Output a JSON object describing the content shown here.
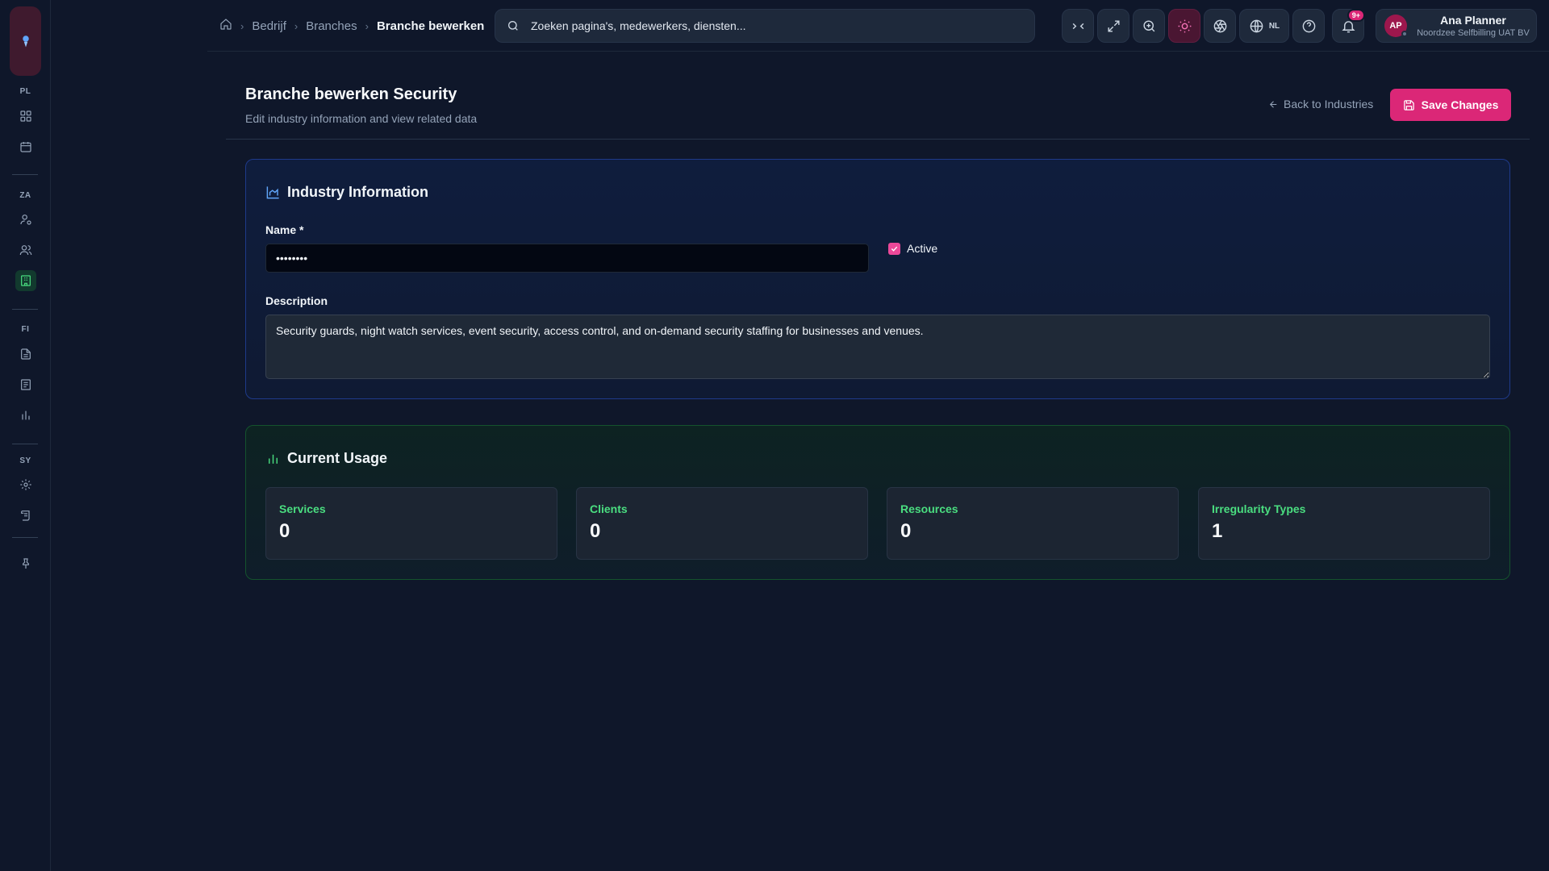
{
  "sidebar": {
    "sections": [
      {
        "label": "PL",
        "items": [
          "dashboard-icon",
          "calendar-icon"
        ]
      },
      {
        "label": "ZA",
        "items": [
          "user-settings-icon",
          "users-icon",
          "building-icon"
        ]
      },
      {
        "label": "FI",
        "items": [
          "file-text-icon",
          "receipt-icon",
          "bar-chart-icon"
        ]
      },
      {
        "label": "SY",
        "items": [
          "settings-icon",
          "scroll-icon"
        ]
      }
    ],
    "active_item": "building-icon",
    "pin_icon": "pin-icon"
  },
  "breadcrumbs": {
    "items": [
      "Bedrijf",
      "Branches"
    ],
    "current": "Branche bewerken"
  },
  "search": {
    "placeholder": "Zoeken pagina's, medewerkers, diensten..."
  },
  "toolbar": {
    "language": "NL",
    "notifications_badge": "9+"
  },
  "user": {
    "initials": "AP",
    "name": "Ana Planner",
    "org": "Noordzee Selfbilling UAT BV"
  },
  "page": {
    "title": "Branche bewerken Security",
    "subtitle": "Edit industry information and view related data",
    "back_label": "Back to Industries",
    "save_label": "Save Changes"
  },
  "industry_info": {
    "title": "Industry Information",
    "name_label": "Name *",
    "name_value": "••••••••",
    "active_label": "Active",
    "active_checked": true,
    "description_label": "Description",
    "description_value": "Security guards, night watch services, event security, access control, and on-demand security staffing for businesses and venues."
  },
  "usage": {
    "title": "Current Usage",
    "stats": [
      {
        "label": "Services",
        "value": "0"
      },
      {
        "label": "Clients",
        "value": "0"
      },
      {
        "label": "Resources",
        "value": "0"
      },
      {
        "label": "Irregularity Types",
        "value": "1"
      }
    ]
  },
  "colors": {
    "accent": "#db2777",
    "success": "#4ade80",
    "info": "#60a5fa",
    "background": "#0f172a"
  }
}
